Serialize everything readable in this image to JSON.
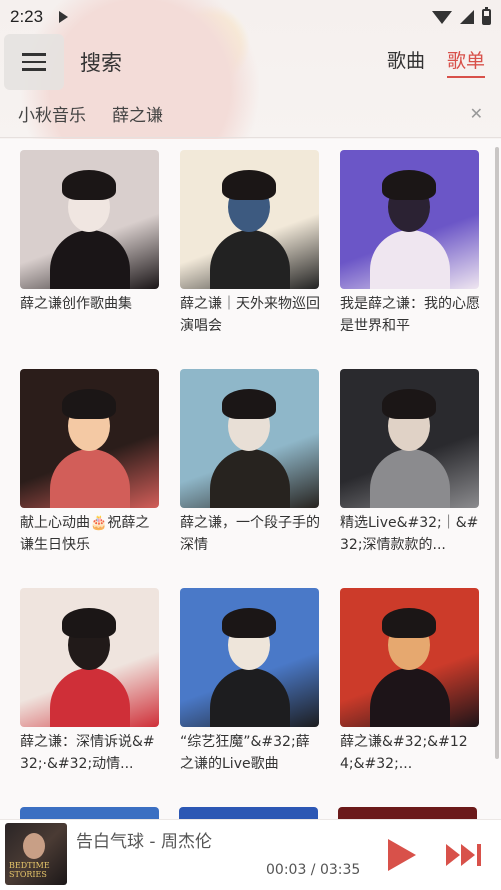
{
  "status_bar": {
    "time": "2:23"
  },
  "app_bar": {
    "title": "搜索",
    "tabs": [
      {
        "label": "歌曲",
        "active": false
      },
      {
        "label": "歌单",
        "active": true
      }
    ]
  },
  "search": {
    "chips": [
      "小秋音乐",
      "薛之谦"
    ],
    "clear_icon": "close-icon"
  },
  "playlists": [
    {
      "title": "薛之谦创作歌曲集",
      "colors": [
        "#d9cfcd",
        "#1a1517",
        "#f0e6e1"
      ]
    },
    {
      "title": "薛之谦｜天外来物巡回演唱会",
      "colors": [
        "#f2e9d9",
        "#222",
        "#3d5a80"
      ]
    },
    {
      "title": "我是薛之谦：我的心愿是世界和平",
      "colors": [
        "#6b56c7",
        "#efe6f0",
        "#2b2233"
      ]
    },
    {
      "title": "献上心动曲🎂祝薛之谦生日快乐",
      "colors": [
        "#2b1d1a",
        "#d25e59",
        "#f4c9a4"
      ]
    },
    {
      "title": "薛之谦，一个段子手的深情",
      "colors": [
        "#8fb7c9",
        "#27231f",
        "#e8dfd6"
      ]
    },
    {
      "title": "精选Live&#32;｜&#32;深情款款的...",
      "colors": [
        "#2a2a2e",
        "#8b8b8e",
        "#e0d2c6"
      ]
    },
    {
      "title": "薛之谦：深情诉说&#32;·&#32;动情...",
      "colors": [
        "#efe4de",
        "#cf2f38",
        "#211a19"
      ]
    },
    {
      "title": "“综艺狂魔”&#32;薛之谦的Live歌曲",
      "colors": [
        "#4a79c8",
        "#1d1d1f",
        "#eee5da"
      ]
    },
    {
      "title": "薛之谦&#32;&#124;&#32;...",
      "colors": [
        "#cc3b2a",
        "#1d1418",
        "#e6a86f"
      ]
    }
  ],
  "partial_row_colors": [
    "#3b6fc2",
    "#2c57b4",
    "#6b1a1a"
  ],
  "player": {
    "song": "告白气球 - 周杰伦",
    "time": "00:03 / 03:35",
    "cover_text": "BEDTIME STORIES",
    "accent": "#d8514a"
  }
}
